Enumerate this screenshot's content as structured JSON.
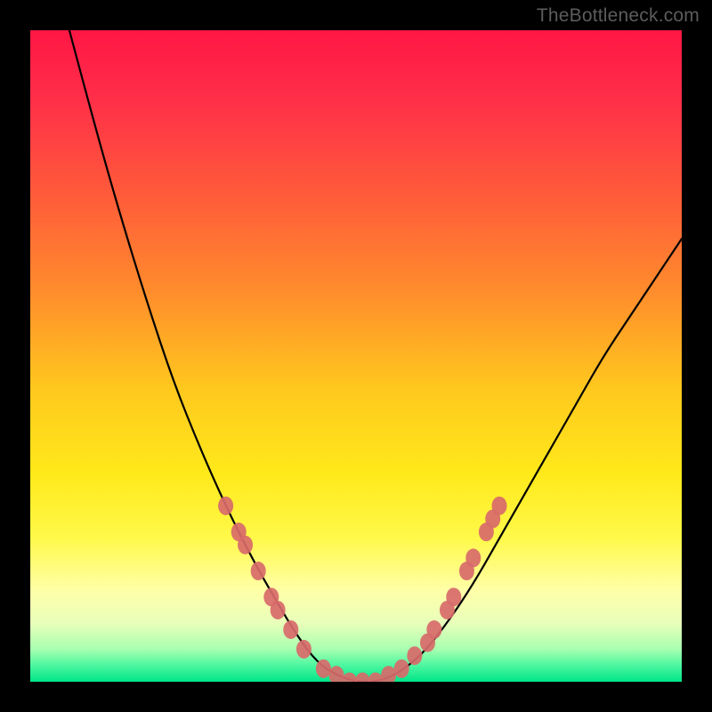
{
  "watermark": "TheBottleneck.com",
  "chart_data": {
    "type": "line",
    "title": "",
    "xlabel": "",
    "ylabel": "",
    "xlim": [
      0,
      100
    ],
    "ylim": [
      0,
      100
    ],
    "grid": false,
    "legend": false,
    "series": [
      {
        "name": "bottleneck-curve",
        "x": [
          6,
          10,
          14,
          18,
          22,
          26,
          30,
          34,
          38,
          41,
          44,
          47,
          50,
          53,
          56,
          60,
          64,
          68,
          72,
          76,
          80,
          84,
          88,
          92,
          96,
          100
        ],
        "y": [
          100,
          85,
          71,
          58,
          46,
          36,
          27,
          19,
          12,
          7,
          3,
          1,
          0,
          0,
          1,
          4,
          9,
          15,
          22,
          29,
          36,
          43,
          50,
          56,
          62,
          68
        ],
        "color": "#000000"
      }
    ],
    "markers": [
      {
        "x": 30,
        "y": 27
      },
      {
        "x": 32,
        "y": 23
      },
      {
        "x": 33,
        "y": 21
      },
      {
        "x": 35,
        "y": 17
      },
      {
        "x": 37,
        "y": 13
      },
      {
        "x": 38,
        "y": 11
      },
      {
        "x": 40,
        "y": 8
      },
      {
        "x": 42,
        "y": 5
      },
      {
        "x": 45,
        "y": 2
      },
      {
        "x": 47,
        "y": 1
      },
      {
        "x": 49,
        "y": 0
      },
      {
        "x": 51,
        "y": 0
      },
      {
        "x": 53,
        "y": 0
      },
      {
        "x": 55,
        "y": 1
      },
      {
        "x": 57,
        "y": 2
      },
      {
        "x": 59,
        "y": 4
      },
      {
        "x": 61,
        "y": 6
      },
      {
        "x": 62,
        "y": 8
      },
      {
        "x": 64,
        "y": 11
      },
      {
        "x": 65,
        "y": 13
      },
      {
        "x": 67,
        "y": 17
      },
      {
        "x": 68,
        "y": 19
      },
      {
        "x": 70,
        "y": 23
      },
      {
        "x": 71,
        "y": 25
      },
      {
        "x": 72,
        "y": 27
      }
    ],
    "marker_color": "#d86a6a",
    "background_gradient": {
      "stops": [
        {
          "offset": 0.0,
          "color": "#ff1744"
        },
        {
          "offset": 0.1,
          "color": "#ff2d49"
        },
        {
          "offset": 0.25,
          "color": "#ff5a3a"
        },
        {
          "offset": 0.4,
          "color": "#ff8c2c"
        },
        {
          "offset": 0.55,
          "color": "#ffc81e"
        },
        {
          "offset": 0.68,
          "color": "#ffe91a"
        },
        {
          "offset": 0.78,
          "color": "#fff94a"
        },
        {
          "offset": 0.86,
          "color": "#ffffa8"
        },
        {
          "offset": 0.91,
          "color": "#e8ffba"
        },
        {
          "offset": 0.95,
          "color": "#a8ffb0"
        },
        {
          "offset": 0.975,
          "color": "#4cf7a0"
        },
        {
          "offset": 1.0,
          "color": "#00e589"
        }
      ]
    }
  }
}
